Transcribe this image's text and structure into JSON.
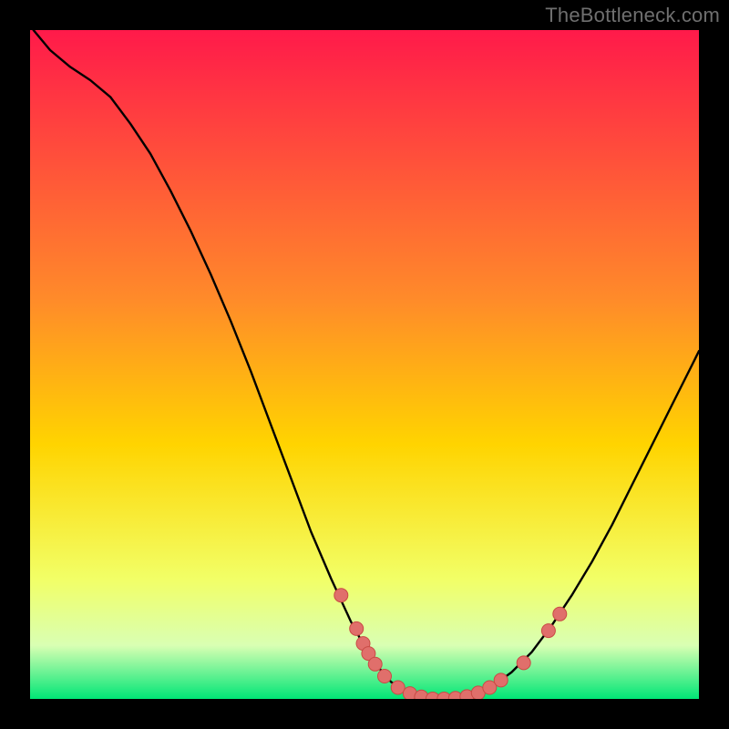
{
  "watermark": "TheBottleneck.com",
  "colors": {
    "bg": "#000000",
    "curve": "#000000",
    "dot_fill": "#e06f6b",
    "dot_stroke": "#c94a44",
    "grad_top": "#ff1a4a",
    "grad_mid_upper": "#ff8a2a",
    "grad_mid": "#ffd400",
    "grad_mid_lower": "#f2ff66",
    "grad_low": "#d9ffb3",
    "grad_bottom": "#00e676"
  },
  "chart_data": {
    "type": "line",
    "title": "",
    "xlabel": "",
    "ylabel": "",
    "xlim": [
      0,
      100
    ],
    "ylim": [
      0,
      100
    ],
    "curve": [
      {
        "x": 0.5,
        "y": 100
      },
      {
        "x": 3,
        "y": 97
      },
      {
        "x": 6,
        "y": 94.5
      },
      {
        "x": 9,
        "y": 92.5
      },
      {
        "x": 12,
        "y": 90
      },
      {
        "x": 15,
        "y": 86
      },
      {
        "x": 18,
        "y": 81.5
      },
      {
        "x": 21,
        "y": 76
      },
      {
        "x": 24,
        "y": 70
      },
      {
        "x": 27,
        "y": 63.5
      },
      {
        "x": 30,
        "y": 56.5
      },
      {
        "x": 33,
        "y": 49
      },
      {
        "x": 36,
        "y": 41
      },
      {
        "x": 39,
        "y": 33
      },
      {
        "x": 42,
        "y": 25
      },
      {
        "x": 45,
        "y": 18
      },
      {
        "x": 48,
        "y": 11.5
      },
      {
        "x": 51,
        "y": 6
      },
      {
        "x": 54,
        "y": 2.5
      },
      {
        "x": 57,
        "y": 0.8
      },
      {
        "x": 60,
        "y": 0
      },
      {
        "x": 63,
        "y": 0
      },
      {
        "x": 66,
        "y": 0.5
      },
      {
        "x": 69,
        "y": 1.8
      },
      {
        "x": 72,
        "y": 4
      },
      {
        "x": 75,
        "y": 7
      },
      {
        "x": 78,
        "y": 11
      },
      {
        "x": 81,
        "y": 15.5
      },
      {
        "x": 84,
        "y": 20.5
      },
      {
        "x": 87,
        "y": 26
      },
      {
        "x": 90,
        "y": 32
      },
      {
        "x": 93,
        "y": 38
      },
      {
        "x": 96,
        "y": 44
      },
      {
        "x": 99,
        "y": 50
      },
      {
        "x": 100,
        "y": 52
      }
    ],
    "dots": [
      {
        "x": 46.5,
        "y": 15.5
      },
      {
        "x": 48.8,
        "y": 10.5
      },
      {
        "x": 49.8,
        "y": 8.3
      },
      {
        "x": 50.6,
        "y": 6.8
      },
      {
        "x": 51.6,
        "y": 5.2
      },
      {
        "x": 53.0,
        "y": 3.4
      },
      {
        "x": 55.0,
        "y": 1.7
      },
      {
        "x": 56.8,
        "y": 0.8
      },
      {
        "x": 58.5,
        "y": 0.3
      },
      {
        "x": 60.2,
        "y": 0.0
      },
      {
        "x": 61.9,
        "y": 0.0
      },
      {
        "x": 63.6,
        "y": 0.1
      },
      {
        "x": 65.3,
        "y": 0.35
      },
      {
        "x": 67.0,
        "y": 0.9
      },
      {
        "x": 68.7,
        "y": 1.7
      },
      {
        "x": 70.4,
        "y": 2.8
      },
      {
        "x": 73.8,
        "y": 5.4
      },
      {
        "x": 77.5,
        "y": 10.2
      },
      {
        "x": 79.2,
        "y": 12.7
      }
    ]
  }
}
